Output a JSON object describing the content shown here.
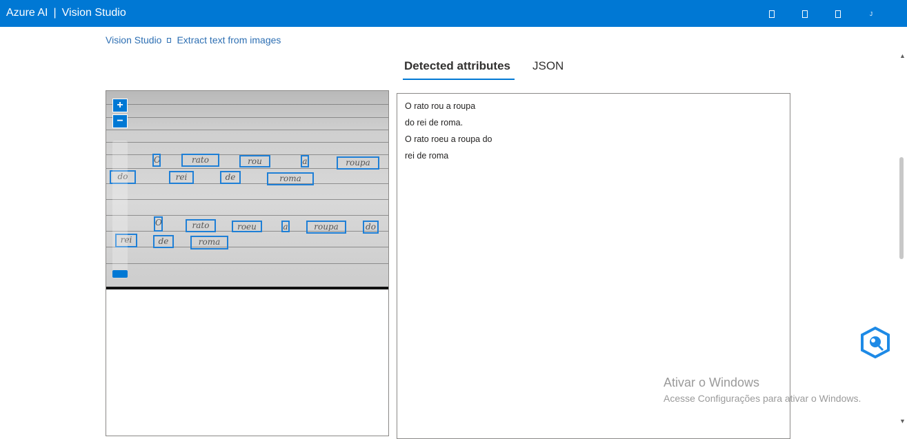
{
  "header": {
    "brand": "Azure AI",
    "separator": "|",
    "product": "Vision Studio",
    "icons": [
      "notifications-icon",
      "settings-icon",
      "help-icon",
      "account-icon"
    ]
  },
  "breadcrumb": {
    "root": "Vision Studio",
    "current": "Extract text from images"
  },
  "tabs": {
    "detected": "Detected attributes",
    "json": "JSON",
    "active": "Detected attributes"
  },
  "image_viewer": {
    "zoom_in": "+",
    "zoom_out": "−",
    "words": [
      "O",
      "rato",
      "rou",
      "a",
      "roupa",
      "do",
      "rei",
      "de",
      "roma",
      "O",
      "rato",
      "roeu",
      "a",
      "roupa",
      "do",
      "rei",
      "de",
      "roma"
    ]
  },
  "result": {
    "lines": [
      "O rato rou a roupa",
      "do rei de roma.",
      "O rato roeu a roupa do",
      "rei de roma"
    ]
  },
  "watermark": {
    "title": "Ativar o Windows",
    "subtitle": "Acesse Configurações para ativar o Windows."
  },
  "colors": {
    "accent": "#0078d4",
    "box": "#1e7fd6"
  }
}
